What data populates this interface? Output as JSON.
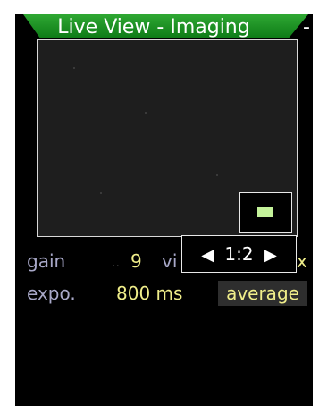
{
  "header": {
    "title": "Live View - Imaging",
    "trailing": "-"
  },
  "settings": {
    "gain_label": "gain",
    "gain_value": "9",
    "view_label_partial": "vi",
    "close_label": "x",
    "exposure_label": "expo.",
    "exposure_value": "800 ms",
    "mode_value": "average"
  },
  "zoom_popup": {
    "prev_arrow": "◀",
    "ratio": "1:2",
    "next_arrow": "▶"
  },
  "colors": {
    "title_green": "#1f9a27",
    "label": "#a8a8c8",
    "value": "#f0ee8a",
    "thumb_fill": "#c4f29a"
  },
  "icons": {
    "prev": "left-triangle-icon",
    "next": "right-triangle-icon"
  }
}
